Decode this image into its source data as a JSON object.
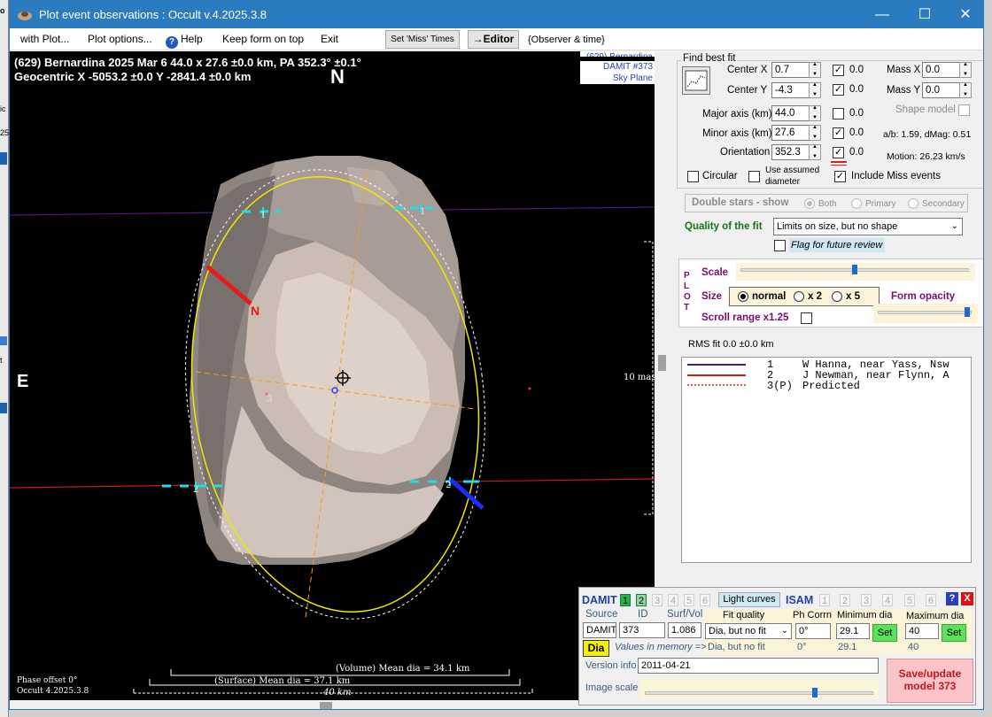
{
  "window": {
    "title": "Plot event observations : Occult v.4.2025.3.8",
    "controls": {
      "minimize": "—",
      "maximize": "☐",
      "close": "✕"
    }
  },
  "left_strip": {
    "fragments": [
      "o",
      "ic",
      "25",
      "t"
    ]
  },
  "menu": {
    "items": [
      "with Plot...",
      "Plot options...",
      "Help",
      "Keep form on top",
      "Exit"
    ],
    "set_miss": "Set 'Miss' Times",
    "editor": "→Editor",
    "observer_time": "{Observer & time}"
  },
  "plot": {
    "header_line1": "(629) Bernardina  2025 Mar 6  44.0 x 27.6 ±0.0 km, PA 352.3° ±0.1°",
    "header_line2": "Geocentric  X  -5053.2 ±0.0  Y -2841.4 ±0.0 km",
    "north": "N",
    "east": "E",
    "damit_lines": [
      "(629) Bernardina",
      "DAMIT #373",
      "Sky Plane"
    ],
    "scale_label": "10 mas",
    "chord_labels": [
      "1",
      "1",
      "2",
      "2",
      "3"
    ],
    "pole_label": "N",
    "phase_offset": "Phase offset 0°",
    "version": "Occult 4.2025.3.8",
    "volume_dia": "(Volume) Mean dia = 34.1 km",
    "surface_dia": "(Surface) Mean dia = 37.1 km",
    "scale_km": "40 km"
  },
  "find_best_fit": {
    "title": "Find best fit",
    "center_x": {
      "label": "Center X",
      "value": "0.7",
      "checked": true,
      "sigma": "0.0"
    },
    "center_y": {
      "label": "Center Y",
      "value": "-4.3",
      "checked": true,
      "sigma": "0.0"
    },
    "major_axis": {
      "label": "Major axis (km)",
      "value": "44.0",
      "checked": false,
      "sigma": "0.0"
    },
    "minor_axis": {
      "label": "Minor axis (km)",
      "value": "27.6",
      "checked": true,
      "sigma": "0.0"
    },
    "orientation": {
      "label": "Orientation",
      "value": "352.3",
      "checked": true,
      "sigma": "0.0"
    },
    "mass_x": {
      "label": "Mass X",
      "value": "0.0"
    },
    "mass_y": {
      "label": "Mass Y",
      "value": "0.0"
    },
    "shape_model": "Shape model",
    "ab_ratio": "a/b: 1.59, dMag: 0.51",
    "motion": "Motion: 26.23 km/s",
    "circular": "Circular",
    "use_assumed_line1": "Use assumed",
    "use_assumed_line2": "diameter",
    "include_miss": "Include Miss events"
  },
  "double_stars": {
    "title": "Double stars - show",
    "both": "Both",
    "primary": "Primary",
    "secondary": "Secondary"
  },
  "quality": {
    "label": "Quality of the fit",
    "value": "Limits on size, but no shape",
    "flag": "Flag for future review"
  },
  "plot_panel": {
    "side_letters": [
      "P",
      "L",
      "O",
      "T"
    ],
    "scale": "Scale",
    "scale_value": 0.5,
    "size": "Size",
    "size_options": [
      "normal",
      "x 2",
      "x 5"
    ],
    "form_opacity": "Form opacity",
    "opacity_value": 0.98,
    "scroll_range": "Scroll range x1.25"
  },
  "rms_fit": "RMS fit 0.0 ±0.0 km",
  "legend": [
    {
      "num": "1",
      "name": "W Hanna, near Yass, Nsw",
      "color": "#4b1a7a",
      "style": "solid"
    },
    {
      "num": "2",
      "name": "J Newman, near Flynn, A",
      "color": "#d01818",
      "style": "solid"
    },
    {
      "num": "3(P)",
      "name": "Predicted",
      "color": "#e05a5a",
      "style": "dotted"
    }
  ],
  "damit": {
    "title": "DAMIT",
    "tabs": [
      "1",
      "2",
      "3",
      "4",
      "5",
      "6"
    ],
    "light_curves": "Light curves",
    "isam": "ISAM",
    "isam_tabs": [
      "1",
      "2",
      "3",
      "4",
      "5",
      "6"
    ],
    "help": "?",
    "close": "X",
    "source_label": "Source",
    "id_label": "ID",
    "surf_vol_label": "Surf/Vol",
    "source": "DAMIT",
    "id": "373",
    "surf_vol": "1.086",
    "fit_quality_label": "Fit quality",
    "fit_quality": "Dia, but no fit",
    "ph_corrn_label": "Ph Corrn",
    "ph_corrn": "0°",
    "min_dia_label": "Minimum dia",
    "min_dia": "29.1",
    "max_dia_label": "Maximum dia",
    "max_dia": "40",
    "set": "Set",
    "dia": "Dia",
    "values_in_memory": "Values in memory =>",
    "mem_fit": "Dia, but no fit",
    "mem_ph": "0°",
    "mem_min": "29.1",
    "mem_max": "40",
    "version_label": "Version info",
    "version": "2011-04-21",
    "image_scale": "Image scale",
    "image_scale_value": 0.75,
    "save": "Save/update model 373"
  }
}
